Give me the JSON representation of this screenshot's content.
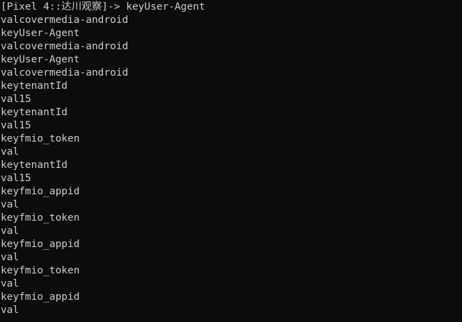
{
  "prompt": {
    "text": "[Pixel 4::达川观察]-> keyUser-Agent"
  },
  "lines": [
    "valcovermedia-android",
    "keyUser-Agent",
    "valcovermedia-android",
    "keyUser-Agent",
    "valcovermedia-android",
    "keytenantId",
    "val15",
    "keytenantId",
    "val15",
    "keyfmio_token",
    "val",
    "keytenantId",
    "val15",
    "keyfmio_appid",
    "val",
    "keyfmio_token",
    "val",
    "keyfmio_appid",
    "val",
    "keyfmio_token",
    "val",
    "keyfmio_appid",
    "val"
  ],
  "colors": {
    "background": "#0c0c0c",
    "foreground": "#cccccc"
  }
}
